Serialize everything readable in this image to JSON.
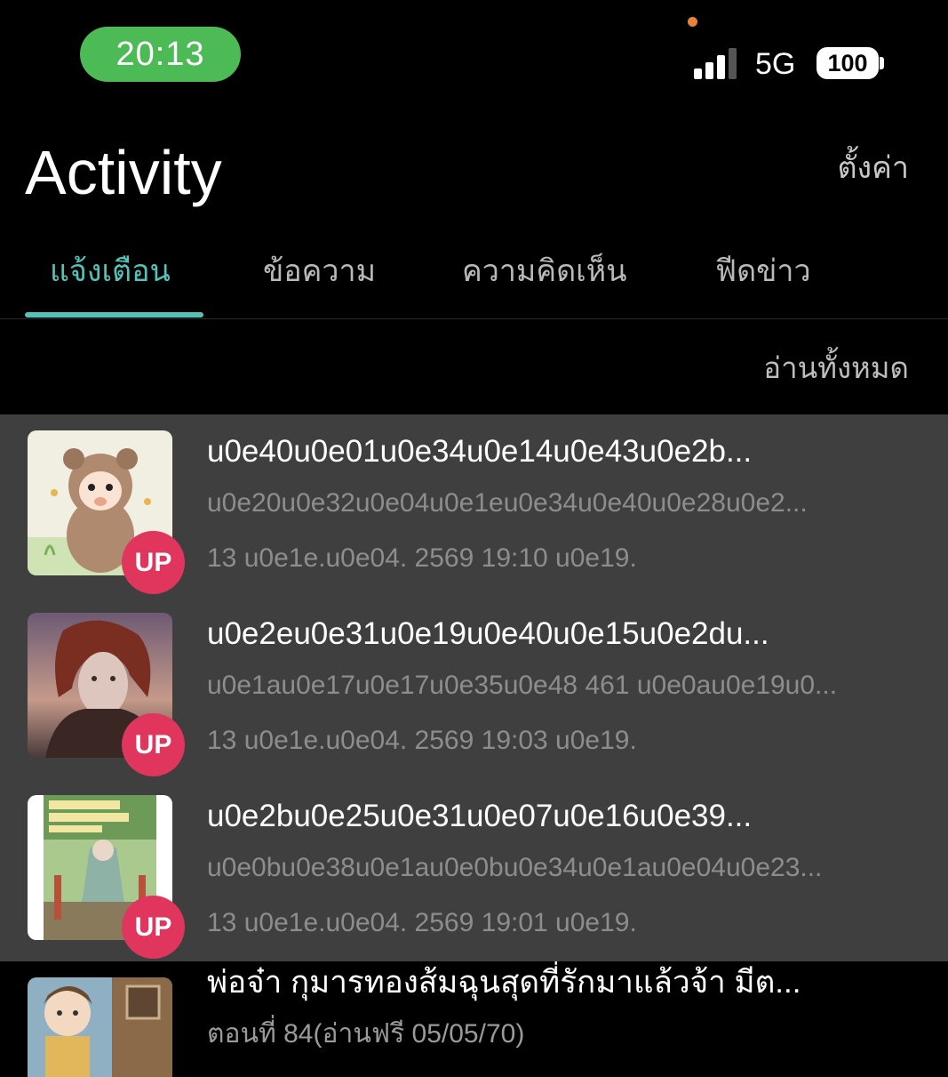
{
  "status_bar": {
    "time": "20:13",
    "network": "5G",
    "battery": "100",
    "time_pill_color": "#4cba55"
  },
  "header": {
    "title": "Activity",
    "settings_label": "ตั้งค่า"
  },
  "tabs": [
    {
      "label": "แจ้งเตือน",
      "active": true
    },
    {
      "label": "ข้อความ",
      "active": false
    },
    {
      "label": "ความคิดเห็น",
      "active": false
    },
    {
      "label": "ฟีดข่าว",
      "active": false
    }
  ],
  "read_all_label": "อ่านทั้งหมด",
  "accent_color": "#52c3b9",
  "badge_color": "#e0365e",
  "notifications": [
    {
      "title": "u0e40u0e01u0e34u0e14u0e43u0e2b...",
      "subtitle": "u0e20u0e32u0e04u0e1eu0e34u0e40u0e28u0e2...",
      "time": "13 u0e1e.u0e04. 2569 19:10 u0e19.",
      "badge": "UP",
      "thumb": "bear-costume-cover",
      "unread": true
    },
    {
      "title": "u0e2eu0e31u0e19u0e40u0e15u0e2du...",
      "subtitle": "u0e1au0e17u0e17u0e35u0e48 461 u0e0au0e19u0...",
      "time": "13 u0e1e.u0e04. 2569 19:03 u0e19.",
      "badge": "UP",
      "thumb": "red-hair-man-cover",
      "unread": true
    },
    {
      "title": "u0e2bu0e25u0e31u0e07u0e16u0e39...",
      "subtitle": "u0e0bu0e38u0e1au0e0bu0e34u0e1au0e04u0e23...",
      "time": "13 u0e1e.u0e04. 2569 19:01 u0e19.",
      "badge": "UP",
      "thumb": "green-robe-cover",
      "unread": true
    },
    {
      "title": "พ่อจ๋า กุมารทองส้มฉุนสุดที่รักมาแล้วจ้า มีต...",
      "subtitle": "ตอนที่ 84(อ่านฟรี 05/05/70)",
      "time": "",
      "badge": "",
      "thumb": "child-house-cover",
      "unread": false
    }
  ]
}
